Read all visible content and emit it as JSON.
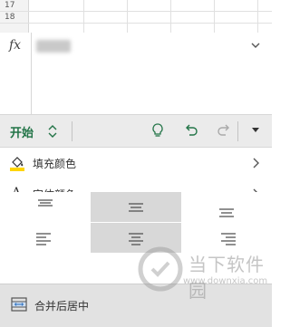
{
  "sheet": {
    "rows": [
      "17",
      "18"
    ]
  },
  "formula_bar": {
    "fx_label": "fx",
    "expand_icon": "chevron-down-icon"
  },
  "ribbon": {
    "tab_label": "开始",
    "tab_switch_icon": "up-down-chevron-icon",
    "accent_color": "#227447",
    "icons": [
      "lightbulb-icon",
      "undo-icon",
      "redo-icon",
      "caret-down-icon"
    ]
  },
  "format_list": {
    "fill_color": {
      "label": "填充颜色",
      "icon": "paint-bucket-icon",
      "swatch": "#ffd500"
    },
    "font_color": {
      "label": "字体颜色",
      "icon": "font-color-icon",
      "swatch": "#e60000"
    }
  },
  "alignment": {
    "rows": [
      [
        "align-top-icon",
        "align-middle-icon",
        "align-bottom-icon"
      ],
      [
        "align-left-icon",
        "align-center-icon",
        "align-right-icon"
      ]
    ],
    "selected": [
      "align-middle-icon",
      "align-center-icon"
    ]
  },
  "merge": {
    "label": "合并后居中",
    "icon": "merge-cells-icon"
  },
  "watermark": {
    "text": "当下软件园",
    "url": "www.downxia.com"
  }
}
